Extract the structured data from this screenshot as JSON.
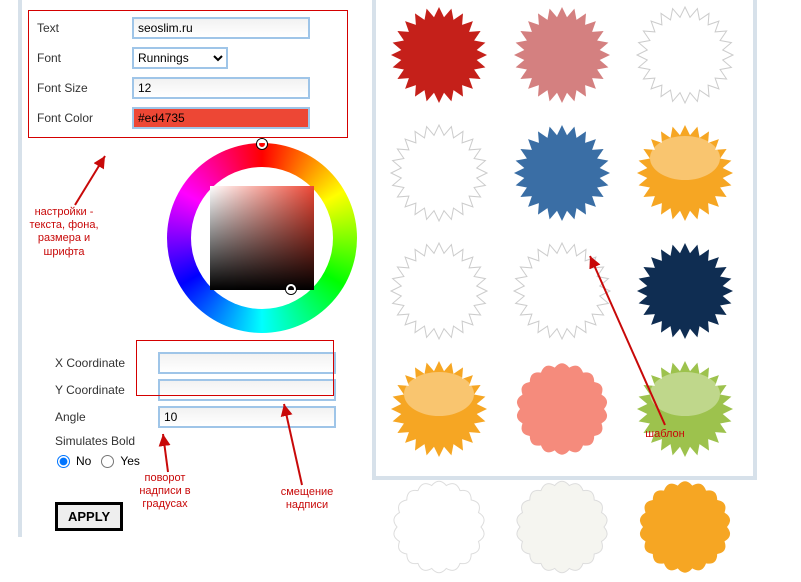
{
  "form": {
    "text_label": "Text",
    "text_value": "seoslim.ru",
    "font_label": "Font",
    "font_value": "Runnings",
    "fontsize_label": "Font Size",
    "fontsize_value": "12",
    "fontcolor_label": "Font Color",
    "fontcolor_value": "#ed4735",
    "xcoord_label": "X Coordinate",
    "xcoord_value": "",
    "ycoord_label": "Y Coordinate",
    "ycoord_value": "",
    "angle_label": "Angle",
    "angle_value": "10",
    "simbold_label": "Simulates Bold",
    "no_label": "No",
    "yes_label": "Yes",
    "apply_label": "APPLY"
  },
  "annotations": {
    "settings": "настройки - текста, фона, размера и шрифта",
    "rotation": "поворот надписи в градусах",
    "offset": "смещение надписи",
    "template": "шаблон"
  },
  "templates": [
    {
      "color": "#c5201a",
      "type": "star"
    },
    {
      "color": "#d48080",
      "type": "star"
    },
    {
      "color": "#ffffff",
      "type": "star",
      "stroke": "#ccc"
    },
    {
      "color": "#ffffff",
      "type": "star",
      "stroke": "#ccc"
    },
    {
      "color": "#3a6ea5",
      "type": "star"
    },
    {
      "color": "#f6a623",
      "type": "star",
      "gloss": true
    },
    {
      "color": "#ffffff",
      "type": "star",
      "stroke": "#ccc"
    },
    {
      "color": "#ffffff",
      "type": "star",
      "stroke": "#ccc"
    },
    {
      "color": "#0f2d52",
      "type": "star"
    },
    {
      "color": "#f6a623",
      "type": "star",
      "gloss": true
    },
    {
      "color": "#f58b7c",
      "type": "scallop"
    },
    {
      "color": "#9dc24d",
      "type": "star",
      "gloss": true
    },
    {
      "color": "#ffffff",
      "type": "scallop",
      "stroke": "#ddd"
    },
    {
      "color": "#f5f5f0",
      "type": "scallop",
      "stroke": "#ddd"
    },
    {
      "color": "#f6a623",
      "type": "scallop"
    }
  ]
}
